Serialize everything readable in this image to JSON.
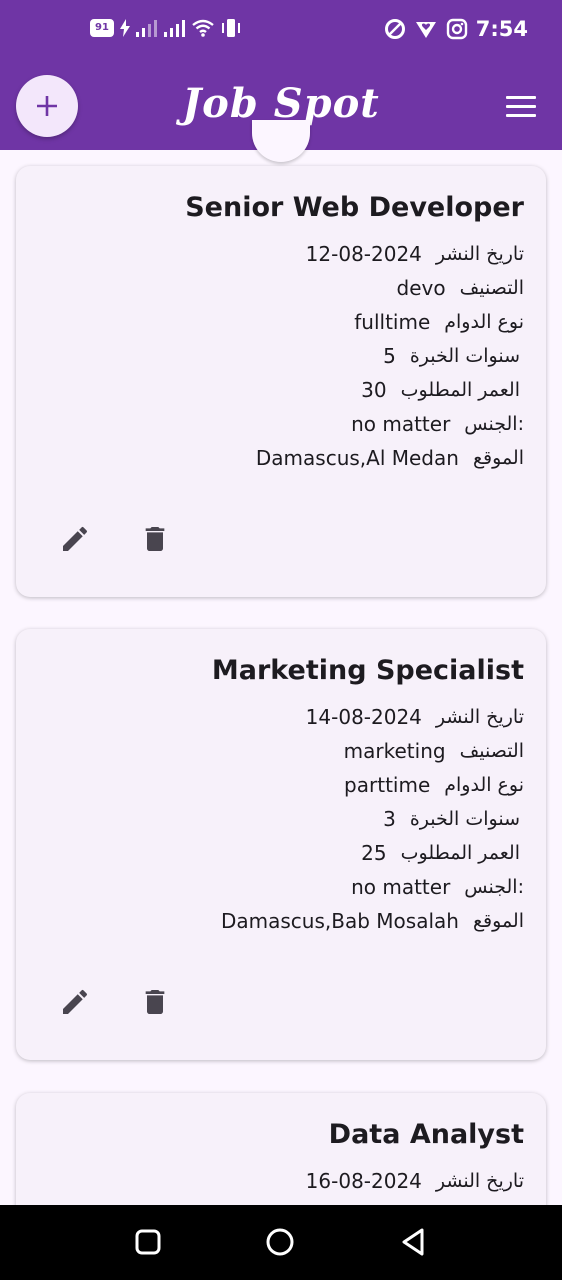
{
  "status_bar": {
    "battery": "91",
    "time": "7:54"
  },
  "app_bar": {
    "logo": "Job Spot"
  },
  "jobs": [
    {
      "title": "Senior Web Developer",
      "published_label": "تاريخ النشر",
      "published": "12-08-2024",
      "category_label": "التصنيف",
      "category": "devo",
      "worktime_label": "نوع الدوام",
      "worktime": "fulltime",
      "experience_label": "سنوات الخبرة",
      "experience": "5",
      "age_label": "العمر المطلوب",
      "age": "30",
      "gender_label": "الجنس:",
      "gender": "no matter",
      "location_label": "الموقع",
      "location": "Damascus,Al Medan"
    },
    {
      "title": "Marketing Specialist",
      "published_label": "تاريخ النشر",
      "published": "14-08-2024",
      "category_label": "التصنيف",
      "category": "marketing",
      "worktime_label": "نوع الدوام",
      "worktime": "parttime",
      "experience_label": "سنوات الخبرة",
      "experience": "3",
      "age_label": "العمر المطلوب",
      "age": "25",
      "gender_label": "الجنس:",
      "gender": "no matter",
      "location_label": "الموقع",
      "location": "Damascus,Bab Mosalah"
    },
    {
      "title": "Data Analyst",
      "published_label": "تاريخ النشر",
      "published": "16-08-2024"
    }
  ],
  "colors": {
    "primary": "#6f35a5",
    "background": "#fcf6ff",
    "card": "#f7f1fa",
    "icon": "#49454f"
  }
}
